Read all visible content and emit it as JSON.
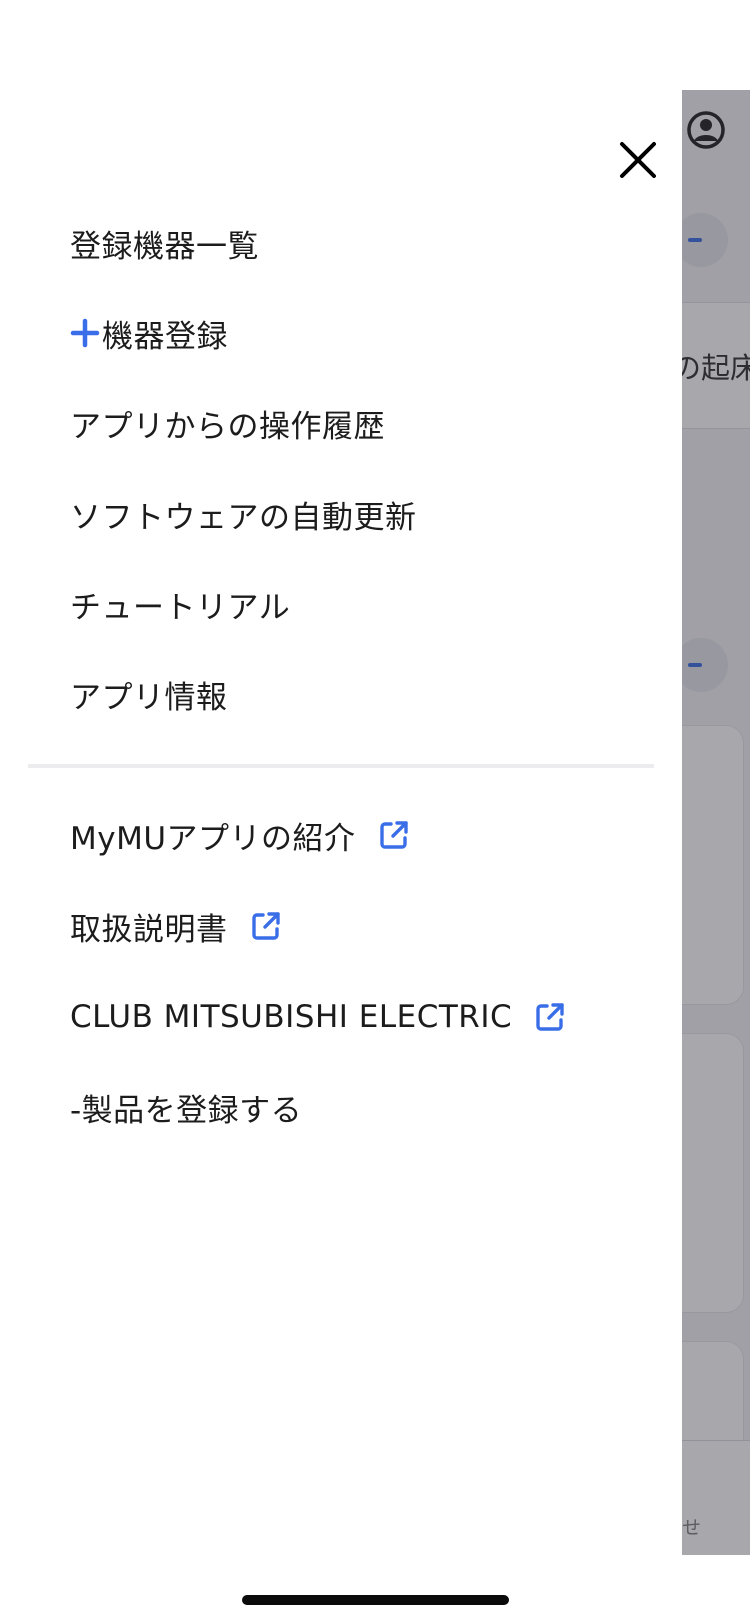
{
  "menu": {
    "items": [
      {
        "label": "登録機器一覧"
      },
      {
        "label": "機器登録",
        "icon": "plus-icon"
      },
      {
        "label": "アプリからの操作履歴"
      },
      {
        "label": "ソフトウェアの自動更新"
      },
      {
        "label": "チュートリアル"
      },
      {
        "label": "アプリ情報"
      }
    ],
    "links": [
      {
        "label": "MyMUアプリの紹介",
        "icon": "external-link-icon"
      },
      {
        "label": "取扱説明書",
        "icon": "external-link-icon"
      },
      {
        "label": "CLUB MITSUBISHI ELECTRIC",
        "icon": "external-link-icon"
      },
      {
        "label": "-製品を登録する"
      }
    ]
  },
  "background": {
    "band_text": "の起床",
    "bottom_text": "せ"
  },
  "colors": {
    "accent": "#3a6ee8",
    "text": "#1c1c1c"
  }
}
